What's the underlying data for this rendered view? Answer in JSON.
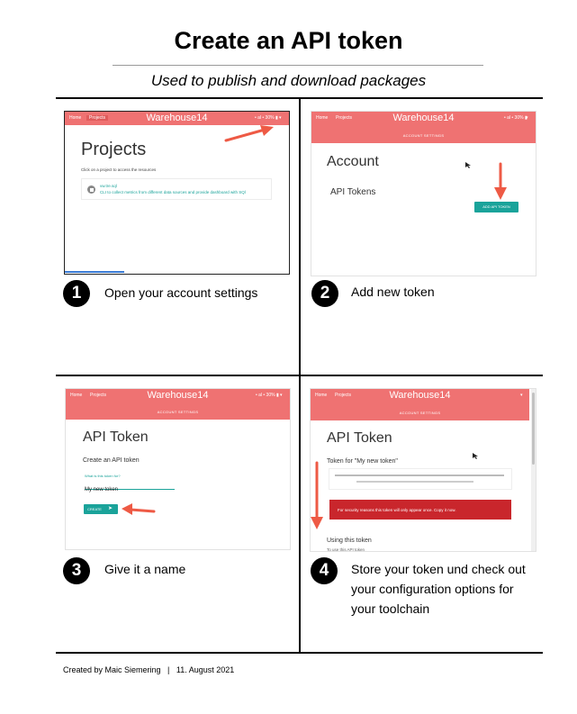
{
  "title": "Create an API token",
  "subtitle": "Used to publish and download packages",
  "app": {
    "brand": "Warehouse14",
    "nav_home": "Home",
    "nav_projects": "Projects",
    "account_settings": "ACCOUNT SETTINGS",
    "status": "• al • 30% ▮",
    "menu_caret": "▾"
  },
  "panel1": {
    "heading": "Projects",
    "hint": "Click on a project to access the resources",
    "project_name": "vw.tre.sql",
    "project_desc": "CLI to collect metrics from different data sources and provide dashboard with SQl"
  },
  "panel2": {
    "heading": "Account",
    "section": "API Tokens",
    "button": "ADD API TOKEN"
  },
  "panel3": {
    "heading": "API Token",
    "subheading": "Create an API token",
    "field_label": "What is this token for?",
    "field_value": "My new token",
    "button": "CREATE"
  },
  "panel4": {
    "heading": "API Token",
    "token_for": "Token for \"My new token\"",
    "warning": "For security reasons this token will only appear once. Copy it now.",
    "using": "Using this token",
    "using_sub": "To use this API token"
  },
  "steps": [
    {
      "number": "1",
      "text": "Open your account settings"
    },
    {
      "number": "2",
      "text": "Add new token"
    },
    {
      "number": "3",
      "text": "Give it a name"
    },
    {
      "number": "4",
      "line1": "Store your token und check out",
      "line2": "your configuration options for",
      "line3": "your toolchain"
    }
  ],
  "footer": "Created by Maic Siemering   |   11. August 2021",
  "colors": {
    "accent": "#ef7272",
    "teal": "#1aa39a",
    "warning": "#c9262c",
    "arrow": "#ee5a45"
  },
  "icons": {
    "arrow": "arrow-icon",
    "project": "package-icon",
    "send": "send-icon"
  }
}
